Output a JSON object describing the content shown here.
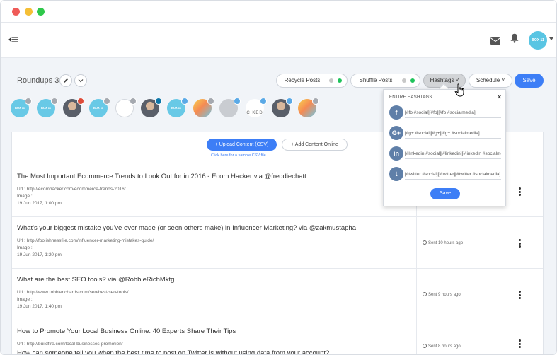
{
  "header": {
    "user_avatar_text": "BOX 11"
  },
  "toolbar": {
    "title": "Roundups 3",
    "recycle_label": "Recycle Posts",
    "shuffle_label": "Shuffle Posts",
    "hashtags_label": "Hashtags",
    "schedule_label": "Schedule",
    "save_label": "Save"
  },
  "accounts": [
    {
      "kind": "blue",
      "text": "BOX 11",
      "badge": "f"
    },
    {
      "kind": "blue",
      "text": "BOX 11",
      "badge": "f"
    },
    {
      "kind": "photo",
      "text": "",
      "badge": "g"
    },
    {
      "kind": "blue",
      "text": "BOX 11",
      "badge": "f"
    },
    {
      "kind": "logo",
      "text": "",
      "badge": "f"
    },
    {
      "kind": "photo",
      "text": "",
      "badge": "in"
    },
    {
      "kind": "blue",
      "text": "BOX 11",
      "badge": "t"
    },
    {
      "kind": "grad",
      "text": "",
      "badge": "f"
    },
    {
      "kind": "gray",
      "text": "",
      "badge": "t"
    },
    {
      "kind": "text-logo",
      "text": "CIKED",
      "badge": "t"
    },
    {
      "kind": "photo",
      "text": "",
      "badge": "t"
    },
    {
      "kind": "grad",
      "text": "",
      "badge": "f"
    }
  ],
  "content": {
    "upload_label": "+ Upload Content (CSV)",
    "add_label": "+ Add Content Online",
    "csv_link": "Click here for a sample CSV file"
  },
  "posts": [
    {
      "title": "The Most Important Ecommerce Trends to Look Out for in 2016 - Ecom Hacker via @freddiechatt",
      "url": "Url : http://ecomhacker.com/ecommerce-trends-2016/",
      "image": "Image :",
      "date": "19 Jun 2017, 1:00 pm",
      "sent": ""
    },
    {
      "title": "What's your biggest mistake you've ever made (or seen others make) in Influencer Marketing? via @zakmustapha",
      "url": "Url : http://foolishnessfile.com/influencer-marketing-mistakes-guide/",
      "image": "Image :",
      "date": "19 Jun 2017, 1:20 pm",
      "sent": "Sent 10 hours ago"
    },
    {
      "title": "What are the best SEO tools? via @RobbieRichMktg",
      "url": "Url : http://www.robbierichards.com/seo/best-seo-tools/",
      "image": "Image :",
      "date": "19 Jun 2017, 1:40 pm",
      "sent": "Sent 9 hours ago"
    },
    {
      "title": "How to Promote Your Local Business Online: 40 Experts Share Their Tips",
      "url": "Url : http://buildfire.com/local-businesses-promotion/",
      "image": "How can someone tell you when the best time to post on Twitter is without using data from your account?",
      "date": "",
      "sent": "Sent 8 hours ago"
    }
  ],
  "hashtags_popover": {
    "heading": "ENTIRE HASHTAGS",
    "close": "×",
    "rows": [
      {
        "network": "facebook-icon",
        "glyph": "f",
        "value": "[#fb #social][#fb][#fb #socialmedia]"
      },
      {
        "network": "google-plus-icon",
        "glyph": "G+",
        "value": "[#g+ #social][#g+][#g+ #socialmedia]"
      },
      {
        "network": "linkedin-icon",
        "glyph": "in",
        "value": "[#linkedin #social][#linkedin][#linkedin #socialmedia]"
      },
      {
        "network": "twitter-icon",
        "glyph": "t",
        "value": "[#twitter #social][#twitter][#twitter #socialmedia]"
      }
    ],
    "save_label": "Save"
  },
  "colors": {
    "accent": "#3d7ef6",
    "toggle_on": "#1fc35b",
    "social_circle": "#5f7fa8"
  }
}
